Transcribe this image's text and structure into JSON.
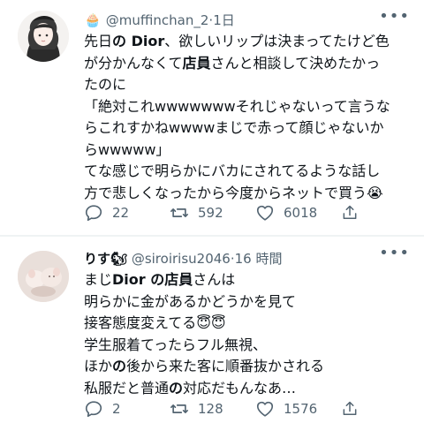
{
  "tweets": [
    {
      "badge_emoji": "🧁",
      "handle": "@muffinchan_2",
      "time": "1日",
      "lines": [
        [
          "先日",
          "の Dior",
          "、欲しいリップは決まってたけど色"
        ],
        [
          "が分かんなくて",
          "店員",
          "さんと相談して決めたかっ"
        ],
        [
          "たのに"
        ],
        [
          "「絶対これwwwwwwwそれじゃないって言うな"
        ],
        [
          "らこれすかねwwwwまじで赤って顔じゃないか"
        ],
        [
          "らwwwww」"
        ],
        [
          "てな感じで明らかにバカにされてるような話し"
        ],
        [
          "方で悲しくなったから今度からネットで買う😭"
        ]
      ],
      "reply_count": "22",
      "retweet_count": "592",
      "like_count": "6018"
    },
    {
      "display_name": "りす🐿",
      "handle": "@siroirisu2046",
      "time": "16 時間",
      "lines": [
        [
          "まじ",
          "Dior の店員",
          "さんは"
        ],
        [
          "明らかに金があるかどうかを見て"
        ],
        [
          "接客態度変えてる😇😇"
        ],
        [
          "学生服着てったらフル無視、"
        ],
        [
          "ほか",
          "の",
          "後から来た客に順番抜かされる"
        ],
        [
          "私服だと普通",
          "の",
          "対応だもんなあ…"
        ]
      ],
      "reply_count": "2",
      "retweet_count": "128",
      "like_count": "1576"
    }
  ]
}
